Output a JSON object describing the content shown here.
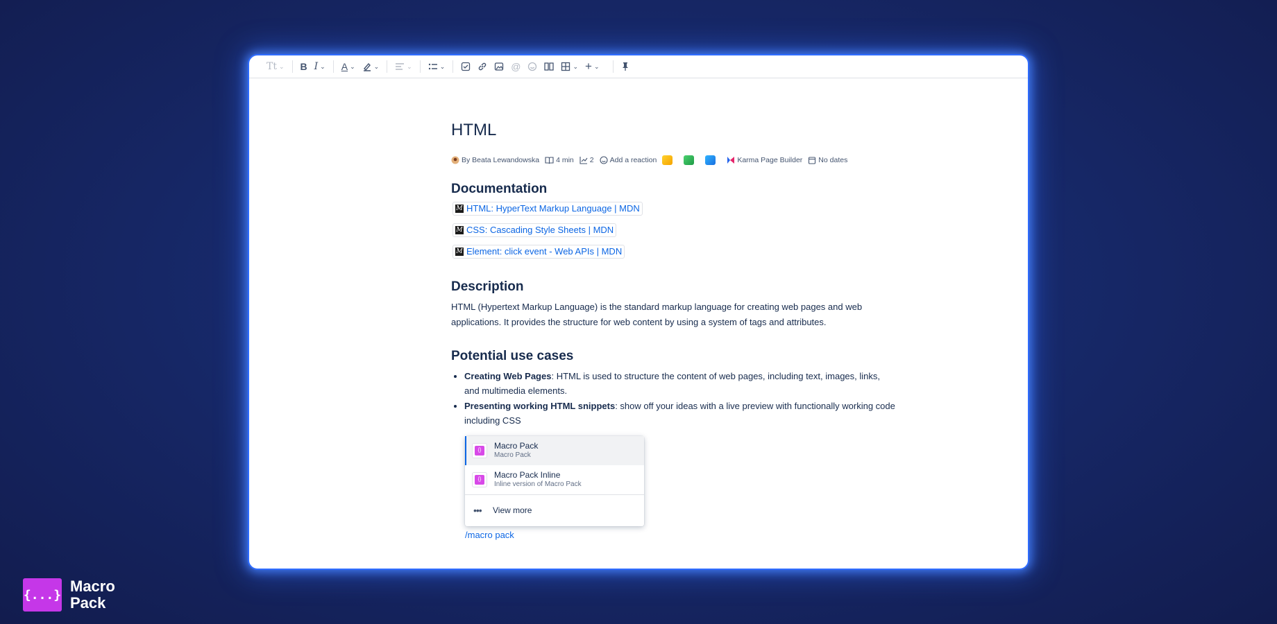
{
  "editor": {
    "title": "HTML",
    "byline": {
      "author": "By Beata Lewandowska",
      "read_time": "4 min",
      "views": "2",
      "reaction": "Add a reaction",
      "app_name": "Karma Page Builder",
      "dates": "No dates"
    },
    "documentation": {
      "heading": "Documentation",
      "links": [
        "HTML: HyperText Markup Language | MDN",
        "CSS: Cascading Style Sheets | MDN",
        "Element: click event - Web APIs | MDN"
      ]
    },
    "description": {
      "heading": "Description",
      "text": "HTML (Hypertext Markup Language) is the standard markup language for creating web pages and web applications. It provides the structure for web content by using a system of tags and attributes."
    },
    "use_cases": {
      "heading": "Potential use cases",
      "items": [
        {
          "bold": "Creating Web Pages",
          "text": ": HTML is used to structure the content of web pages, including text, images, links, and multimedia elements."
        },
        {
          "bold": "Presenting working HTML snippets",
          "text": ": show off your ideas with a live preview with functionally working code including CSS"
        }
      ]
    },
    "slash_command": "/macro pack",
    "menu": {
      "items": [
        {
          "title": "Macro Pack",
          "subtitle": "Macro Pack"
        },
        {
          "title": "Macro Pack Inline",
          "subtitle": "Inline version of Macro Pack"
        }
      ],
      "more": "View more"
    }
  },
  "toolbar": {
    "text_style": "Tt",
    "bold": "B",
    "italic": "I",
    "text_color": "A"
  },
  "brand": {
    "logo": "{...}",
    "line1": "Macro",
    "line2": "Pack"
  },
  "colors": {
    "link": "#0c66e4",
    "accent": "#2f6cff",
    "brand": "#c537e8"
  }
}
